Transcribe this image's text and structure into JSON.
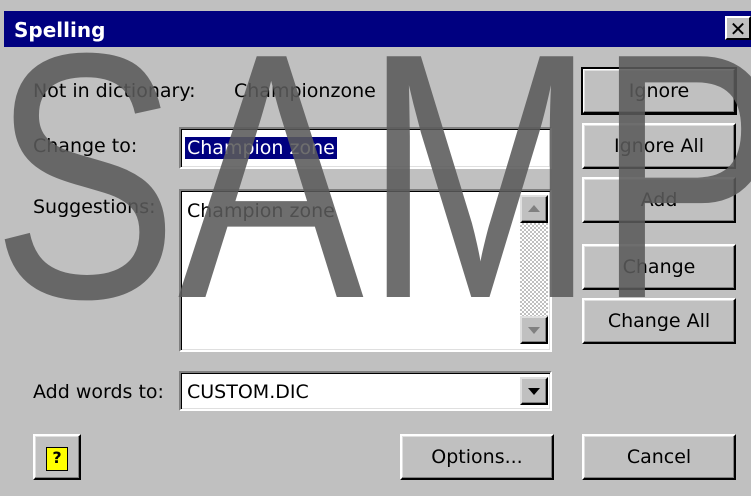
{
  "dialog": {
    "title": "Spelling",
    "close_glyph": "✕"
  },
  "labels": {
    "not_in_dictionary": "Not in dictionary:",
    "change_to": "Change to:",
    "suggestions": "Suggestions:",
    "add_words_to": "Add words to:"
  },
  "word": "Championzone",
  "change_to_value": "Champion zone",
  "suggestions": [
    "Champion zone"
  ],
  "add_words_to_value": "CUSTOM.DIC",
  "buttons": {
    "ignore": "Ignore",
    "ignore_all": "Ignore All",
    "add": "Add",
    "change": "Change",
    "change_all": "Change All",
    "options": "Options...",
    "cancel": "Cancel",
    "help_glyph": "?"
  },
  "watermark": {
    "text": "SAMP",
    "color": "#5a5a5a"
  },
  "colors": {
    "titlebar": "#000080",
    "face": "#c0c0c0",
    "selection": "#000080"
  }
}
